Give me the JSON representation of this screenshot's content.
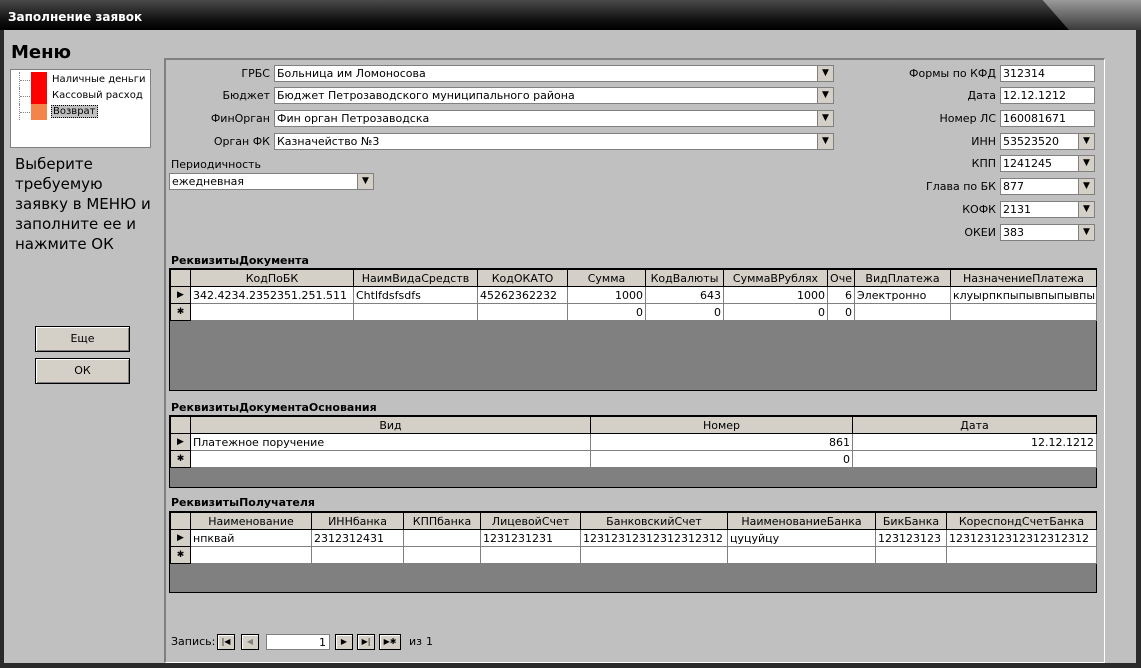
{
  "window": {
    "title": "Заполнение заявок"
  },
  "menu": {
    "title": "Меню",
    "items": [
      {
        "label": "Наличные деньги",
        "color": "#ff0000"
      },
      {
        "label": "Кассовый расход",
        "color": "#ff0000"
      },
      {
        "label": "Возврат",
        "color": "#f4854a"
      }
    ],
    "instructions": "Выберите требуемую заявку в МЕНЮ и заполните ее и нажмите ОК",
    "more_button": "Еще",
    "ok_button": "ОК"
  },
  "form": {
    "grbs": {
      "label": "ГРБС",
      "value": "Больница им Ломоносова"
    },
    "budget": {
      "label": "Бюджет",
      "value": "Бюджет Петрозаводского муниципального района"
    },
    "finorgan": {
      "label": "ФинОрган",
      "value": "Фин орган Петрозаводска"
    },
    "organfk": {
      "label": "Орган ФК",
      "value": "Казначейство №3"
    },
    "periodicity": {
      "label": "Периодичность",
      "value": "ежедневная"
    },
    "kfd": {
      "label": "Формы по КФД",
      "value": "312314"
    },
    "date": {
      "label": "Дата",
      "value": "12.12.1212"
    },
    "ls": {
      "label": "Номер ЛС",
      "value": "160081671"
    },
    "inn": {
      "label": "ИНН",
      "value": "53523520"
    },
    "kpp": {
      "label": "КПП",
      "value": "1241245"
    },
    "glava": {
      "label": "Глава по БК",
      "value": "877"
    },
    "kofk": {
      "label": "КОФК",
      "value": "2131"
    },
    "okei": {
      "label": "ОКЕИ",
      "value": "383"
    }
  },
  "doc": {
    "title": "РеквизитыДокумента",
    "columns": [
      "КодПоБК",
      "НаимВидаСредств",
      "КодОКАТО",
      "Сумма",
      "КодВалюты",
      "СуммаВРублях",
      "Оче",
      "ВидПлатежа",
      "НазначениеПлатежа"
    ],
    "row1": [
      "342.4234.2352351.251.511",
      "Chtlfdsfsdfs",
      "45262362232",
      "1000",
      "643",
      "1000",
      "6",
      "Электронно",
      "клуырпкпыпывпыпывпы"
    ],
    "row2": [
      "",
      "",
      "",
      "0",
      "0",
      "0",
      "0",
      "",
      ""
    ]
  },
  "base": {
    "title": "РеквизитыДокументаОснования",
    "columns": [
      "Вид",
      "Номер",
      "Дата"
    ],
    "row1": [
      "Платежное поручение",
      "861",
      "12.12.1212"
    ],
    "row2": [
      "",
      "0",
      ""
    ]
  },
  "recipient": {
    "title": "РеквизитыПолучателя",
    "columns": [
      "Наименование",
      "ИННбанка",
      "КППбанка",
      "ЛицевойСчет",
      "БанковскийСчет",
      "НаименованиеБанка",
      "БикБанка",
      "КореспондСчетБанка"
    ],
    "row1": [
      "нпквай",
      "2312312431",
      "",
      "1231231231",
      "12312312312312312312",
      "цуцуйцу",
      "123123123",
      "12312312312312312312"
    ]
  },
  "record_nav": {
    "label": "Запись:",
    "current": "1",
    "of_label": "из",
    "total": "1"
  }
}
